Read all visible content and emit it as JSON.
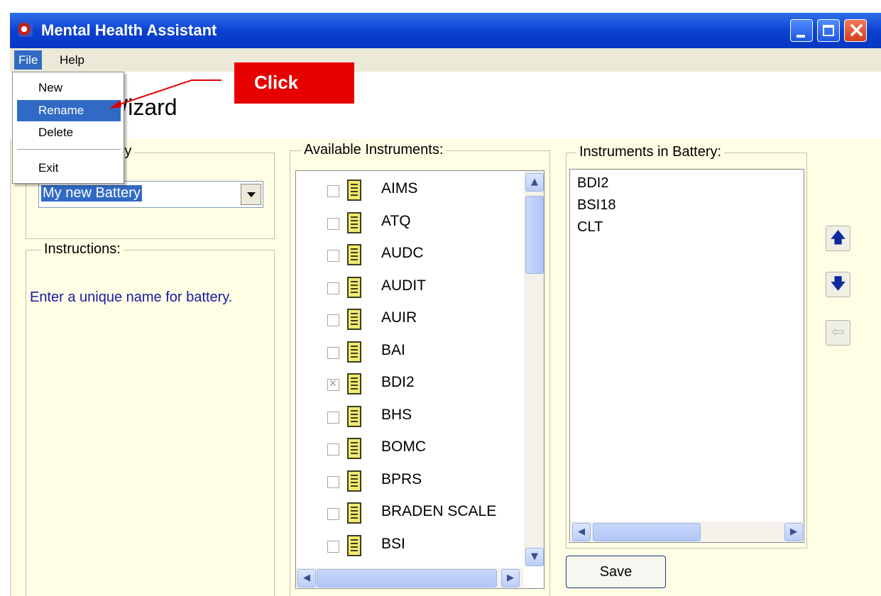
{
  "window": {
    "title": "Mental Health Assistant"
  },
  "menubar": {
    "file": "File",
    "help": "Help"
  },
  "file_menu": {
    "items": [
      "New",
      "Rename",
      "Delete",
      "Exit"
    ],
    "highlighted": "Rename"
  },
  "header": {
    "title": "Wizard"
  },
  "battery_group": {
    "legend": "Battery",
    "selected_value": "My new Battery"
  },
  "instructions": {
    "legend": "Instructions:",
    "text": "Enter a unique name for battery."
  },
  "available": {
    "legend": "Available Instruments:",
    "items": [
      {
        "label": "AIMS",
        "checked": false
      },
      {
        "label": "ATQ",
        "checked": false
      },
      {
        "label": "AUDC",
        "checked": false
      },
      {
        "label": "AUDIT",
        "checked": false
      },
      {
        "label": "AUIR",
        "checked": false
      },
      {
        "label": "BAI",
        "checked": false
      },
      {
        "label": "BDI2",
        "checked": true
      },
      {
        "label": "BHS",
        "checked": false
      },
      {
        "label": "BOMC",
        "checked": false
      },
      {
        "label": "BPRS",
        "checked": false
      },
      {
        "label": "BRADEN SCALE",
        "checked": false
      },
      {
        "label": "BSI",
        "checked": false
      }
    ]
  },
  "in_battery": {
    "legend": "Instruments in Battery:",
    "items": [
      "BDI2",
      "BSI18",
      "CLT"
    ]
  },
  "save_button": {
    "label": "Save"
  },
  "annotation": {
    "label": "Click"
  }
}
